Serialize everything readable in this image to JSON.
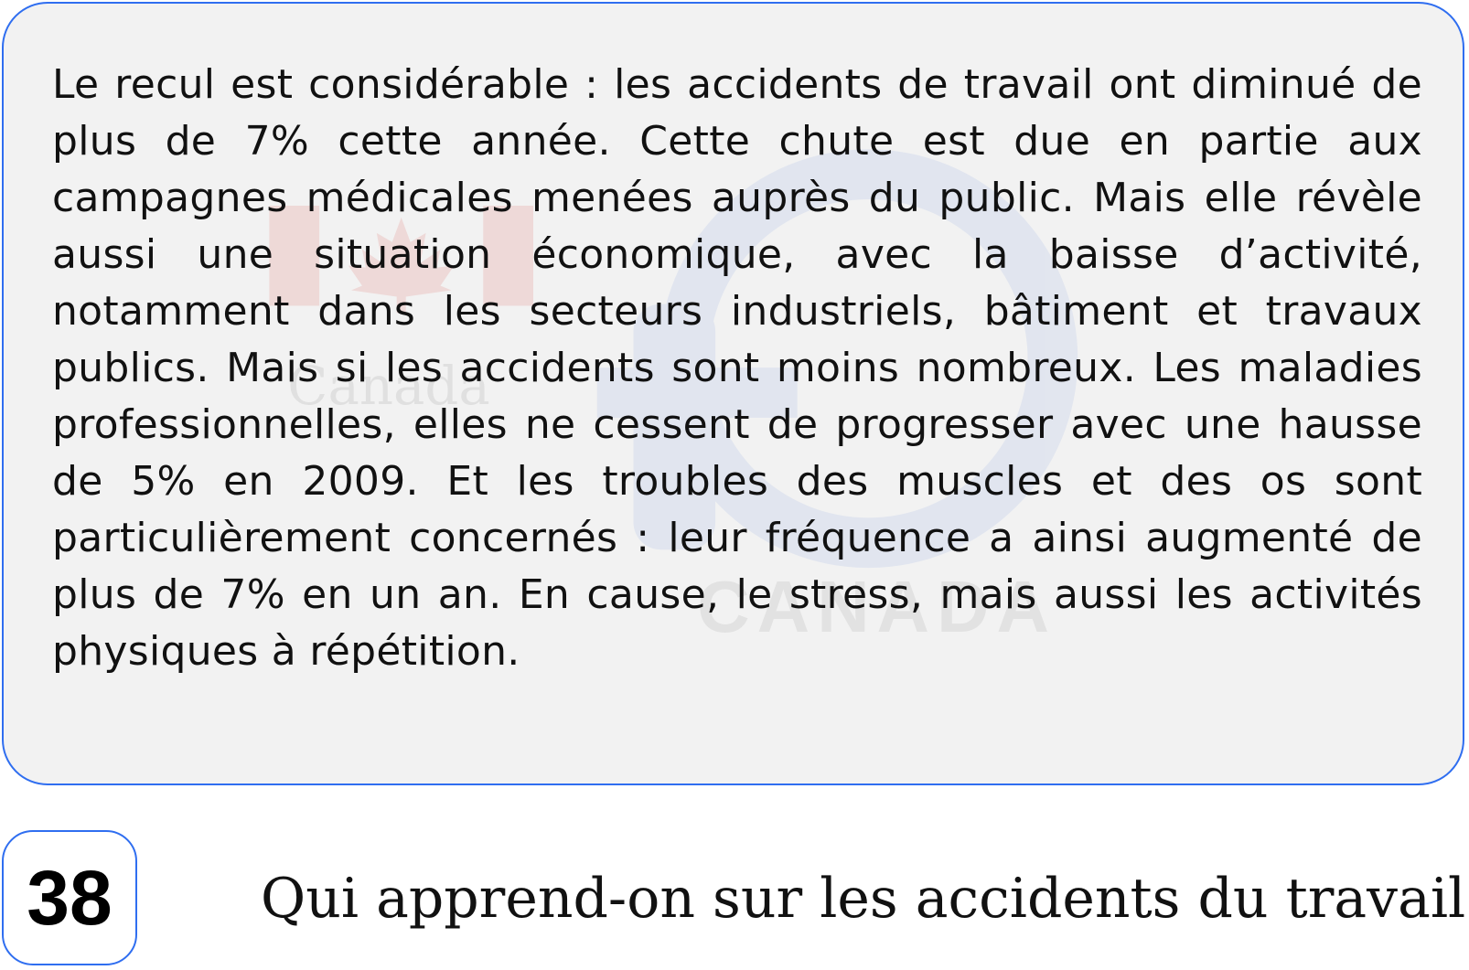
{
  "passage": {
    "text": "Le recul est considérable : les accidents de travail ont diminué de plus de 7% cette année. Cette chute est due en partie aux campagnes médicales menées auprès du public. Mais elle révèle aussi une situation économique, avec la baisse d’activité, notamment dans les secteurs industriels, bâtiment et travaux publics. Mais si les accidents sont moins nombreux. Les maladies professionnelles, elles ne cessent de progresser avec une hausse de 5% en 2009. Et les troubles des muscles et des os sont particulièrement concernés : leur fréquence a ainsi augmenté de plus de 7% en un an. En cause, le stress, mais aussi les activités physiques à répétition."
  },
  "watermark": {
    "left_logo_text": "Canada",
    "center_logo_text": "CANADA"
  },
  "question": {
    "number": "38",
    "text": "Qui apprend-on sur les accidents du travail ?"
  },
  "colors": {
    "accent_border": "#2f6ef0",
    "card_background": "#f2f2f2"
  }
}
